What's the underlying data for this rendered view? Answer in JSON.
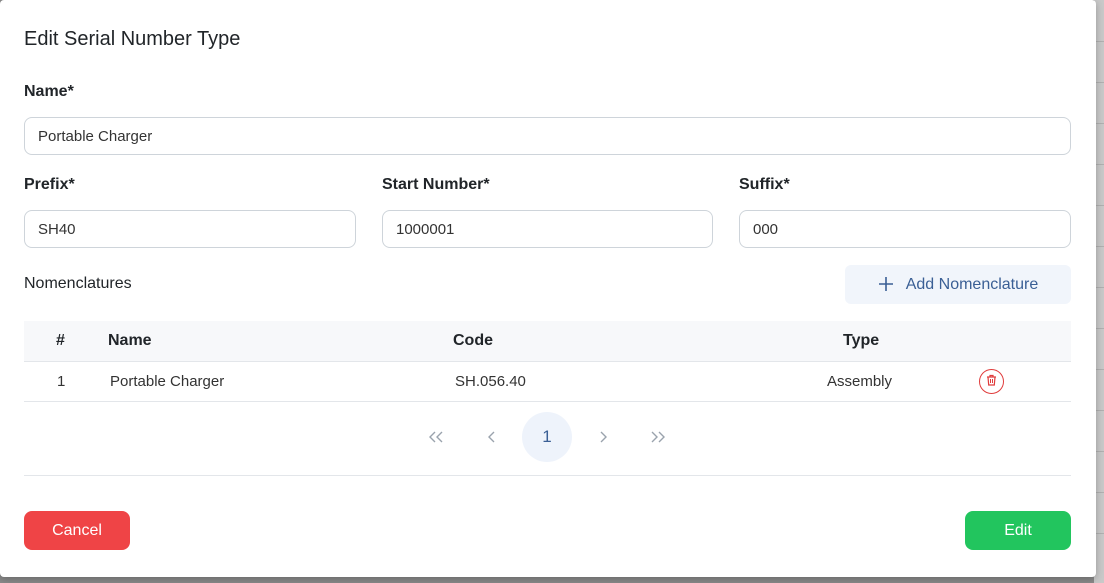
{
  "modal": {
    "title": "Edit Serial Number Type"
  },
  "form": {
    "name_label": "Name*",
    "name_value": "Portable Charger",
    "prefix_label": "Prefix*",
    "prefix_value": "SH40",
    "start_label": "Start Number*",
    "start_value": "1000001",
    "suffix_label": "Suffix*",
    "suffix_value": "000"
  },
  "nomenclatures": {
    "label": "Nomenclatures",
    "add_button": "Add Nomenclature",
    "columns": [
      "#",
      "Name",
      "Code",
      "Type"
    ],
    "rows": [
      {
        "index": "1",
        "name": "Portable Charger",
        "code": "SH.056.40",
        "type": "Assembly"
      }
    ]
  },
  "pagination": {
    "first": "«",
    "prev": "‹",
    "current": "1",
    "next": "›",
    "last": "»"
  },
  "footer": {
    "cancel_label": "Cancel",
    "edit_label": "Edit"
  },
  "colors": {
    "cancel": "#ef4446",
    "edit": "#22c55e",
    "accent": "#3a5f95",
    "danger": "#e03c3c"
  }
}
